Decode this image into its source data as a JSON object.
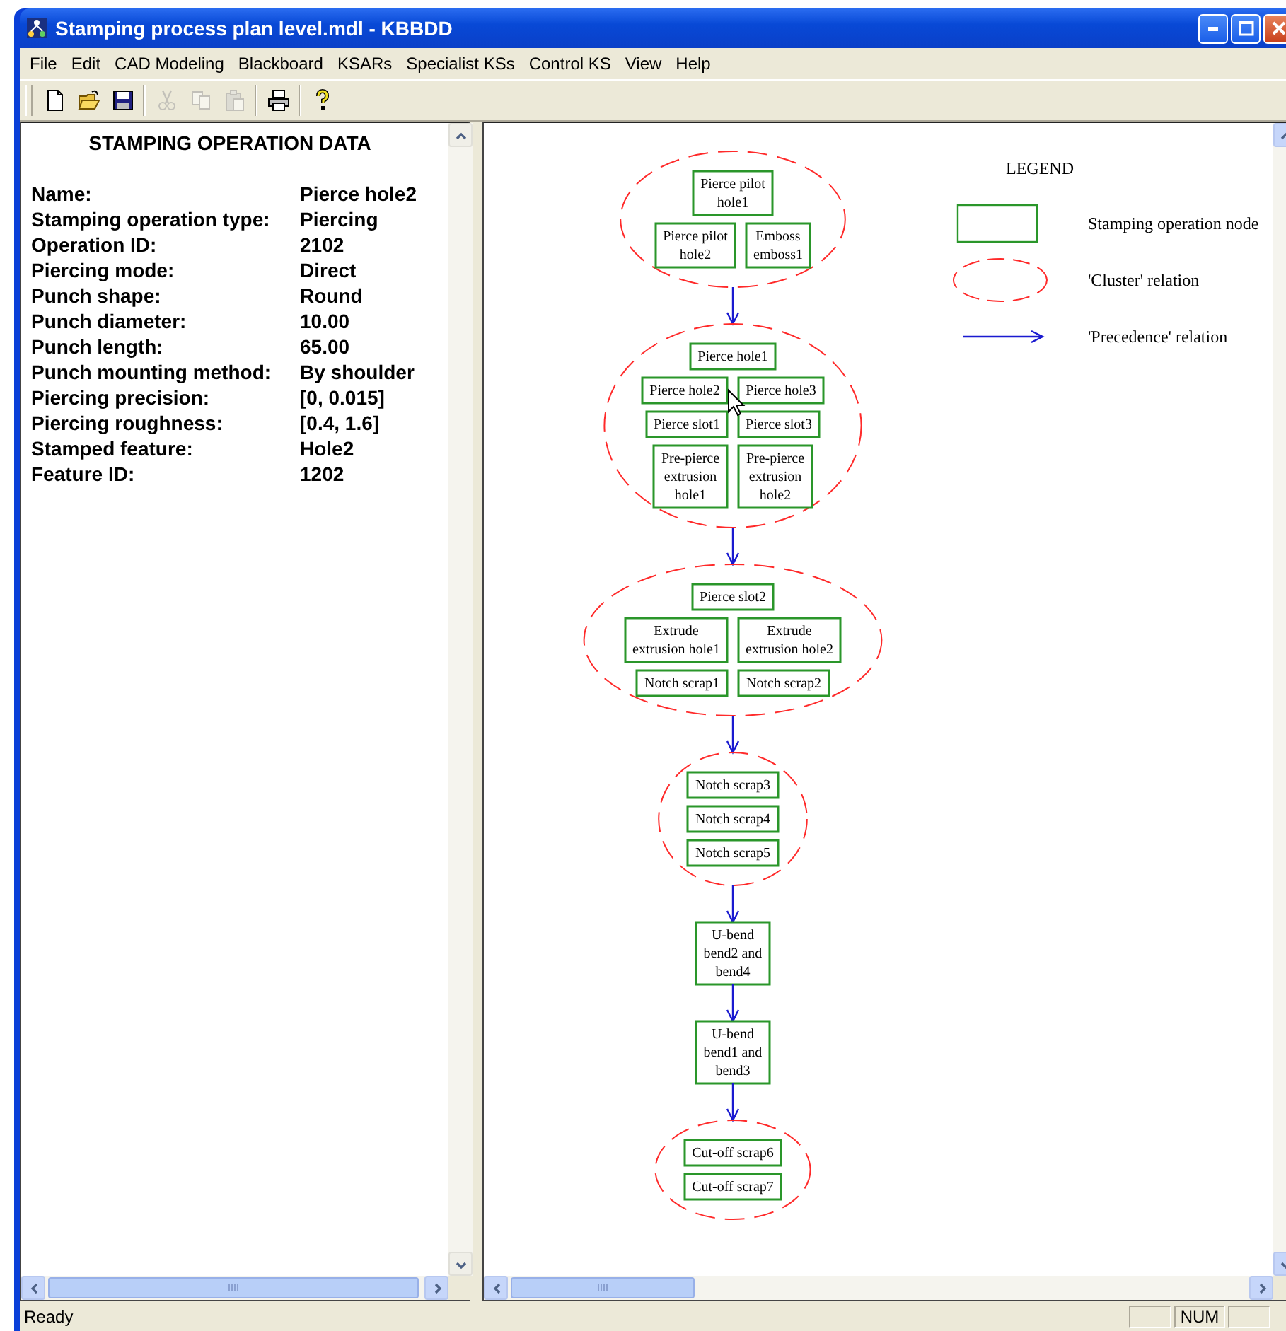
{
  "window": {
    "title": "Stamping process plan level.mdl - KBBDD"
  },
  "menu": [
    "File",
    "Edit",
    "CAD Modeling",
    "Blackboard",
    "KSARs",
    "Specialist KSs",
    "Control KS",
    "View",
    "Help"
  ],
  "toolbar": [
    {
      "kind": "new",
      "disabled": false
    },
    {
      "kind": "open",
      "disabled": false
    },
    {
      "kind": "save",
      "disabled": false
    },
    {
      "kind": "separator"
    },
    {
      "kind": "cut",
      "disabled": true
    },
    {
      "kind": "copy",
      "disabled": true
    },
    {
      "kind": "paste",
      "disabled": true
    },
    {
      "kind": "separator"
    },
    {
      "kind": "print",
      "disabled": false
    },
    {
      "kind": "separator"
    },
    {
      "kind": "help",
      "disabled": false
    }
  ],
  "data_panel": {
    "title": "STAMPING OPERATION DATA",
    "fields": [
      {
        "label": "Name:",
        "value": "Pierce hole2"
      },
      {
        "label": "Stamping operation type:",
        "value": "Piercing"
      },
      {
        "label": "Operation ID:",
        "value": "2102"
      },
      {
        "label": "Piercing mode:",
        "value": "Direct"
      },
      {
        "label": "Punch shape:",
        "value": "Round"
      },
      {
        "label": "Punch diameter:",
        "value": "10.00"
      },
      {
        "label": "Punch length:",
        "value": "65.00"
      },
      {
        "label": "Punch mounting method:",
        "value": "By shoulder"
      },
      {
        "label": "Piercing precision:",
        "value": "[0, 0.015]"
      },
      {
        "label": "Piercing roughness:",
        "value": "[0.4, 1.6]"
      },
      {
        "label": "Stamped feature:",
        "value": "Hole2"
      },
      {
        "label": "Feature ID:",
        "value": "1202"
      }
    ]
  },
  "diagram": {
    "legend": {
      "title": "LEGEND",
      "items": [
        {
          "kind": "node",
          "label": "Stamping operation node"
        },
        {
          "kind": "cluster",
          "label": "'Cluster' relation"
        },
        {
          "kind": "precedence",
          "label": "'Precedence' relation"
        }
      ]
    },
    "flow": [
      {
        "kind": "cluster",
        "rows": [
          [
            {
              "lines": [
                "Pierce pilot",
                "hole1"
              ],
              "pointer": false
            }
          ],
          [
            {
              "lines": [
                "Pierce pilot",
                "hole2"
              ],
              "pointer": false
            },
            {
              "lines": [
                "Emboss",
                "emboss1"
              ],
              "pointer": false
            }
          ]
        ]
      },
      {
        "kind": "cluster",
        "rows": [
          [
            {
              "lines": [
                "Pierce hole1"
              ],
              "pointer": false
            }
          ],
          [
            {
              "lines": [
                "Pierce hole2"
              ],
              "pointer": true
            },
            {
              "lines": [
                "Pierce hole3"
              ],
              "pointer": false
            }
          ],
          [
            {
              "lines": [
                "Pierce slot1"
              ],
              "pointer": false
            },
            {
              "lines": [
                "Pierce slot3"
              ],
              "pointer": false
            }
          ],
          [
            {
              "lines": [
                "Pre-pierce",
                "extrusion",
                "hole1"
              ],
              "pointer": false
            },
            {
              "lines": [
                "Pre-pierce",
                "extrusion",
                "hole2"
              ],
              "pointer": false
            }
          ]
        ]
      },
      {
        "kind": "cluster",
        "rows": [
          [
            {
              "lines": [
                "Pierce slot2"
              ],
              "pointer": false
            }
          ],
          [
            {
              "lines": [
                "Extrude",
                "extrusion hole1"
              ],
              "pointer": false
            },
            {
              "lines": [
                "Extrude",
                "extrusion hole2"
              ],
              "pointer": false
            }
          ],
          [
            {
              "lines": [
                "Notch scrap1"
              ],
              "pointer": false
            },
            {
              "lines": [
                "Notch scrap2"
              ],
              "pointer": false
            }
          ]
        ]
      },
      {
        "kind": "cluster",
        "rows": [
          [
            {
              "lines": [
                "Notch scrap3"
              ],
              "pointer": false
            }
          ],
          [
            {
              "lines": [
                "Notch scrap4"
              ],
              "pointer": false
            }
          ],
          [
            {
              "lines": [
                "Notch scrap5"
              ],
              "pointer": false
            }
          ]
        ]
      },
      {
        "kind": "node",
        "lines": [
          "U-bend",
          "bend2 and",
          "bend4"
        ],
        "pointer": false
      },
      {
        "kind": "node",
        "lines": [
          "U-bend",
          "bend1 and",
          "bend3"
        ],
        "pointer": false
      },
      {
        "kind": "cluster",
        "rows": [
          [
            {
              "lines": [
                "Cut-off scrap6"
              ],
              "pointer": false
            }
          ],
          [
            {
              "lines": [
                "Cut-off scrap7"
              ],
              "pointer": false
            }
          ]
        ]
      }
    ]
  },
  "status_bar": {
    "text": "Ready",
    "indicators": [
      {
        "kind": "blank"
      },
      {
        "kind": "text",
        "text": "NUM"
      },
      {
        "kind": "blank"
      }
    ]
  }
}
